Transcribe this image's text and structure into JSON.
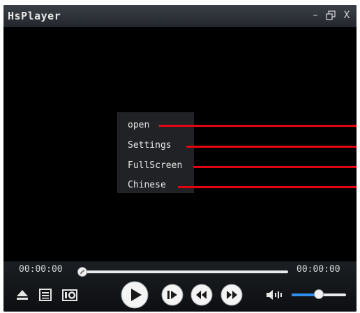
{
  "window": {
    "title": "HsPlayer",
    "minimize_label": "–",
    "close_label": "X"
  },
  "context_menu": {
    "items": [
      {
        "label": "open"
      },
      {
        "label": "Settings"
      },
      {
        "label": "FullScreen"
      },
      {
        "label": "Chinese"
      }
    ]
  },
  "controls": {
    "current_time": "00:00:00",
    "total_time": "00:00:00",
    "seek_progress": 0,
    "volume_level": 0.5
  },
  "icons": {
    "minimize": "minimize-icon",
    "restore": "restore-icon",
    "close": "close-icon",
    "eject": "eject-icon",
    "playlist": "playlist-icon",
    "snapshot": "camera-icon",
    "play": "play-icon",
    "frame_step": "frame-step-icon",
    "rewind": "rewind-icon",
    "forward": "fast-forward-icon",
    "volume": "volume-icon"
  },
  "colors": {
    "callout_lines": "#e3000f",
    "volume_fill": "#2f8fe8",
    "background": "#000000"
  }
}
